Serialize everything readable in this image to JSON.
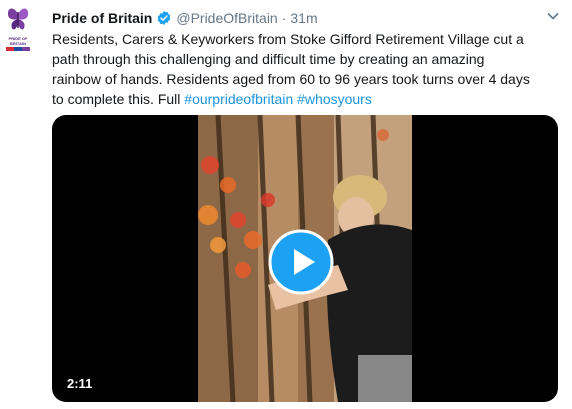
{
  "tweet": {
    "author_name": "Pride of Britain",
    "handle": "@PrideOfBritain",
    "separator": "·",
    "time": "31m",
    "text_lines": [
      "Residents, Carers & Keyworkers from Stoke Gifford Retirement Village cut a",
      "path through this challenging and difficult time by creating an amazing",
      "rainbow of hands. Residents aged from 60 to 96 years took turns over 4 days"
    ],
    "last_line_prefix": "to complete this. Full ",
    "hashtags": [
      "#ourprideofbritain",
      "#whosyours"
    ],
    "avatar_text": [
      "PRIDE OF",
      "BRITAIN"
    ]
  },
  "video": {
    "duration": "2:11"
  },
  "colors": {
    "link": "#1b95e0",
    "verified": "#1da1f2",
    "play": "#1da1f2",
    "brand_purple": "#5a2a83"
  },
  "icons": {
    "verified": "verified-badge-icon",
    "caret": "chevron-down-icon",
    "play": "play-icon"
  }
}
